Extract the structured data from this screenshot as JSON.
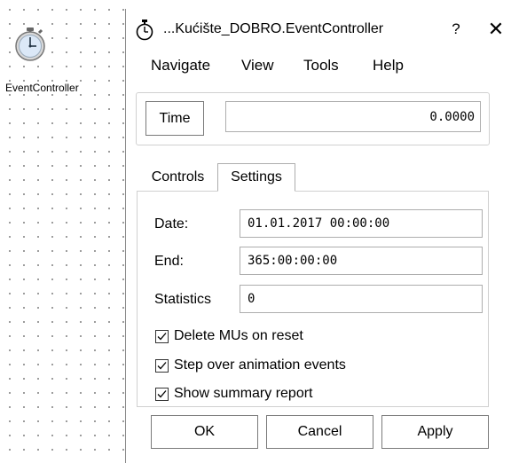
{
  "canvas": {
    "object_label": "EventController",
    "object_icon": "stopwatch-icon"
  },
  "dialog": {
    "title": "...Kućište_DOBRO.EventController",
    "title_icon": "stopwatch-icon",
    "help_label": "?",
    "close_label": "✕"
  },
  "menu": {
    "items": [
      "Navigate",
      "View",
      "Tools",
      "Help"
    ]
  },
  "time": {
    "button_label": "Time",
    "value": "0.0000"
  },
  "tabs": {
    "items": [
      "Controls",
      "Settings"
    ],
    "active": "Settings"
  },
  "settings": {
    "date_label": "Date:",
    "date_value": "01.01.2017 00:00:00",
    "end_label": "End:",
    "end_value": "365:00:00:00",
    "statistics_label": "Statistics",
    "statistics_value": "0",
    "checkboxes": [
      {
        "label": "Delete MUs on reset",
        "checked": true
      },
      {
        "label": "Step over animation events",
        "checked": true
      },
      {
        "label": "Show summary report",
        "checked": true
      }
    ]
  },
  "buttons": {
    "ok": "OK",
    "cancel": "Cancel",
    "apply": "Apply"
  }
}
